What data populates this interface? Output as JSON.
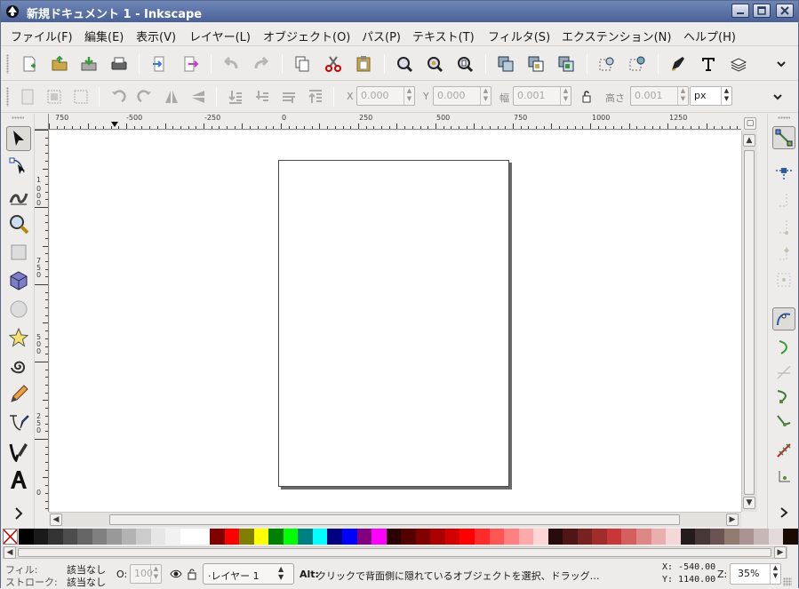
{
  "window": {
    "title": "新規ドキュメント 1 - Inkscape",
    "icons": [
      "inkscape-icon",
      "minimize-icon",
      "maximize-icon",
      "close-icon"
    ]
  },
  "menu": [
    "ファイル(F)",
    "編集(E)",
    "表示(V)",
    "レイヤー(L)",
    "オブジェクト(O)",
    "パス(P)",
    "テキスト(T)",
    "フィルタ(S)",
    "エクステンション(N)",
    "ヘルプ(H)"
  ],
  "commands_toolbar": {
    "icons": [
      "new-icon",
      "open-icon",
      "save-icon",
      "print-icon",
      "import-icon",
      "export-icon",
      "undo-icon",
      "redo-icon",
      "copy-icon",
      "cut-icon",
      "paste-icon",
      "zoom-selection-icon",
      "zoom-drawing-icon",
      "zoom-page-icon",
      "duplicate-icon",
      "clone-icon",
      "unlink-clone-icon",
      "group-icon",
      "ungroup-icon",
      "fill-stroke-icon",
      "text-font-icon",
      "layers-icon",
      "overflow-chevron-icon"
    ]
  },
  "tool_controls": {
    "x_label": "X",
    "x_value": "0.000",
    "y_label": "Y",
    "y_value": "0.000",
    "w_label": "幅",
    "w_value": "0.001",
    "h_label": "高さ",
    "h_value": "0.001",
    "unit": "px"
  },
  "toolbox": {
    "tools": [
      "selector-tool-icon",
      "node-tool-icon",
      "tweak-tool-icon",
      "zoom-tool-icon",
      "rect-tool-icon",
      "3dbox-tool-icon",
      "ellipse-tool-icon",
      "star-tool-icon",
      "spiral-tool-icon",
      "pencil-tool-icon",
      "pen-tool-icon",
      "calligraphy-tool-icon",
      "text-tool-icon",
      "more-tools-icon"
    ],
    "active": "selector-tool-icon"
  },
  "rulers": {
    "horizontal": [
      "750",
      "-500",
      "-250",
      "0",
      "250",
      "500",
      "750",
      "1000",
      "1250"
    ],
    "vertical": [
      "1",
      "0",
      "0",
      "0",
      "7",
      "5",
      "0",
      "5",
      "0",
      "0",
      "2",
      "5",
      "0",
      "0"
    ]
  },
  "palette": {
    "colors": [
      "#000000",
      "#1a1a1a",
      "#333333",
      "#4d4d4d",
      "#666666",
      "#808080",
      "#999999",
      "#b3b3b3",
      "#cccccc",
      "#e6e6e6",
      "#f2f2f2",
      "#ffffff",
      "#ffffff",
      "#800000",
      "#ff0000",
      "#808000",
      "#ffff00",
      "#008000",
      "#00ff00",
      "#008080",
      "#00ffff",
      "#000080",
      "#0000ff",
      "#800080",
      "#ff00ff",
      "#2b0000",
      "#550000",
      "#800000",
      "#aa0000",
      "#d40000",
      "#ff0000",
      "#ff2a2a",
      "#ff5555",
      "#ff8080",
      "#ffaaaa",
      "#ffd5d5",
      "#280b0b",
      "#501616",
      "#782121",
      "#a02c2c",
      "#c83737",
      "#d35f5f",
      "#de8787",
      "#e9afaf",
      "#f4d7d7",
      "#241c1c",
      "#483737",
      "#6c5353",
      "#917c6f",
      "#ac9393",
      "#c8b7b7",
      "#e3dbdb",
      "#1a0a00"
    ]
  },
  "status": {
    "fill_label": "フィル:",
    "fill_value": "該当なし",
    "stroke_label": "ストローク:",
    "stroke_value": "該当なし",
    "opacity_label": "O:",
    "opacity_value": "100",
    "layer": "·レイヤー 1",
    "message_key": "Alt:",
    "message": " クリックで背面側に隠れているオブジェクトを選択、ドラッグ…",
    "cursor_x": "X: -540.00",
    "cursor_y": "Y: 1140.00",
    "zoom_label": "Z:",
    "zoom": "35%"
  }
}
